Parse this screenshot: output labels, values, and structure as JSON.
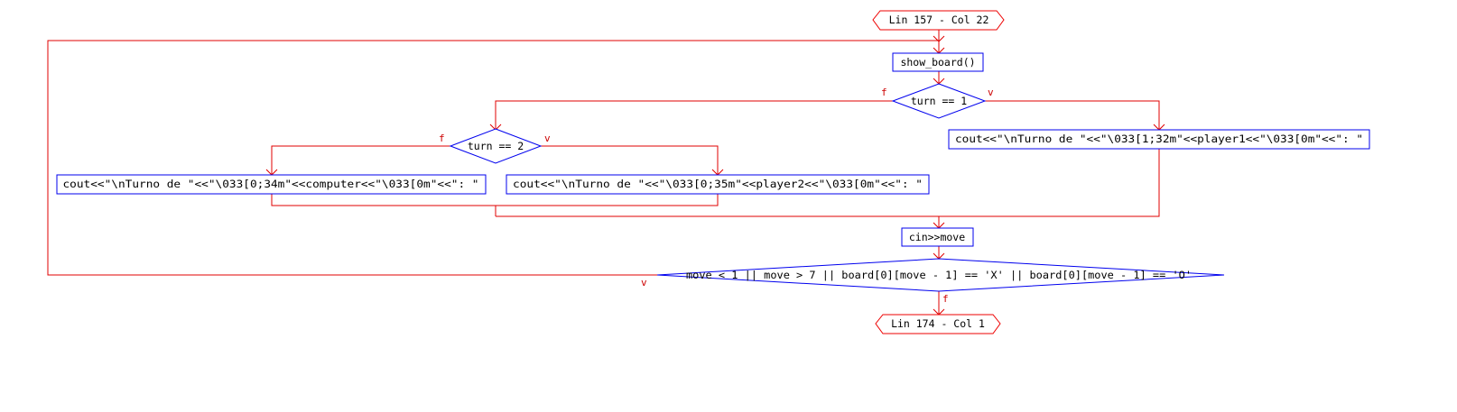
{
  "flowchart": {
    "start_terminal": "Lin 157 - Col 22",
    "end_terminal": "Lin 174 - Col 1",
    "show_board": "show_board()",
    "decision_turn1": "turn == 1",
    "decision_turn2": "turn == 2",
    "print_player1": "cout<<\"\\nTurno de \"<<\"\\033[1;32m\"<<player1<<\"\\033[0m\"<<\": \"",
    "print_player2": "cout<<\"\\nTurno de \"<<\"\\033[0;35m\"<<player2<<\"\\033[0m\"<<\": \"",
    "print_computer": "cout<<\"\\nTurno de \"<<\"\\033[0;34m\"<<computer<<\"\\033[0m\"<<\": \"",
    "read_move": "cin>>move",
    "loop_condition": "move < 1 || move > 7 || board[0][move - 1] == 'X' || board[0][move - 1] == 'O'",
    "true_label": "v",
    "false_label": "f"
  },
  "colors": {
    "connector": "#e00000",
    "box_border": "#0000ee",
    "terminal_border": "#ee0000",
    "label": "#cc0000"
  }
}
